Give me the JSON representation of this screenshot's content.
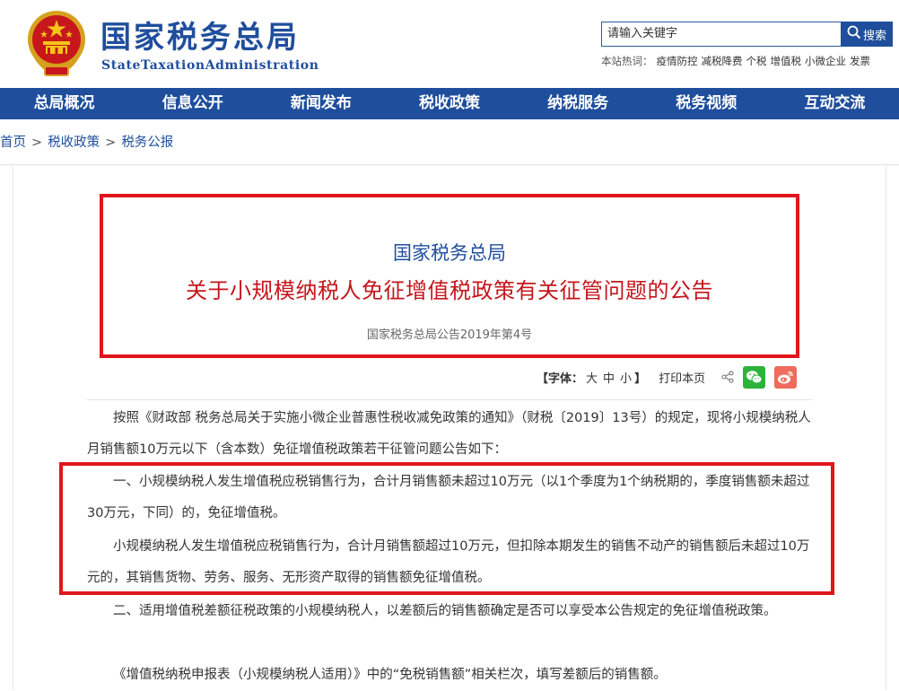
{
  "header": {
    "title": "国家税务总局",
    "subtitle": "StateTaxationAdministration",
    "search_placeholder": "请输入关键字",
    "search_button": "搜索",
    "hotwords_label": "本站热词：",
    "hotwords": [
      "疫情防控",
      "减税降费",
      "个税",
      "增值税",
      "小微企业",
      "发票"
    ]
  },
  "nav": {
    "items": [
      "总局概况",
      "信息公开",
      "新闻发布",
      "税收政策",
      "纳税服务",
      "税务视频",
      "互动交流"
    ]
  },
  "breadcrumb": {
    "items": [
      "首页",
      "税收政策",
      "税务公报"
    ],
    "separator": ">"
  },
  "article": {
    "org": "国家税务总局",
    "title": "关于小规模纳税人免征增值税政策有关征管问题的公告",
    "doc_no": "国家税务总局公告2019年第4号",
    "font_label": "【字体：",
    "font_sizes": [
      "大",
      "中",
      "小"
    ],
    "font_close": "】",
    "print_label": "打印本页",
    "paragraphs": [
      "按照《财政部 税务总局关于实施小微企业普惠性税收减免政策的通知》（财税〔2019〕13号）的规定，现将小规模纳税人月销售额10万元以下（含本数）免征增值税政策若干征管问题公告如下：",
      "一、小规模纳税人发生增值税应税销售行为，合计月销售额未超过10万元（以1个季度为1个纳税期的，季度销售额未超过30万元，下同）的，免征增值税。",
      "小规模纳税人发生增值税应税销售行为，合计月销售额超过10万元，但扣除本期发生的销售不动产的销售额后未超过10万元的，其销售货物、劳务、服务、无形资产取得的销售额免征增值税。",
      "二、适用增值税差额征税政策的小规模纳税人，以差额后的销售额确定是否可以享受本公告规定的免征增值税政策。",
      "《增值税纳税申报表（小规模纳税人适用）》中的“免税销售额”相关栏次，填写差额后的销售额。"
    ]
  },
  "colors": {
    "brand_blue": "#1f4e9c",
    "title_red": "#c4161c",
    "highlight_red": "#e0161c",
    "wechat_green": "#2db33a",
    "weibo_red": "#ef6c5c"
  },
  "icons": [
    "national-emblem-icon",
    "search-icon",
    "share-icon",
    "wechat-icon",
    "weibo-icon"
  ]
}
